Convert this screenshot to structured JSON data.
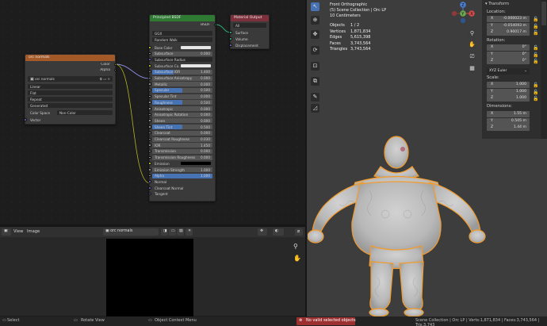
{
  "node_editor": {
    "orc_node": {
      "title": "orc normals",
      "outputs": [
        "Color",
        "Alpha"
      ],
      "image_name": "orc normals",
      "interpolation": "Linear",
      "projection": "Flat",
      "extension": "Repeat",
      "source": "Generated",
      "color_space_label": "Color Space",
      "color_space_value": "Non-Color",
      "vector_label": "Vector"
    },
    "bsdf_node": {
      "title": "Principled BSDF",
      "output": "BSDF",
      "distribution": "GGX",
      "subsurface_method": "Random Walk",
      "rows": [
        {
          "label": "Base Color",
          "value": "",
          "type": "color"
        },
        {
          "label": "Subsurface",
          "value": "0.000",
          "type": "field"
        },
        {
          "label": "Subsurface Radius",
          "value": "",
          "type": "dd"
        },
        {
          "label": "Subsurface Co...",
          "value": "",
          "type": "color"
        },
        {
          "label": "Subsurface IOR",
          "value": "1.400",
          "type": "blue"
        },
        {
          "label": "Subsurface Anisotropy",
          "value": "0.000",
          "type": "field"
        },
        {
          "label": "Metallic",
          "value": "0.000",
          "type": "field"
        },
        {
          "label": "Specular",
          "value": "0.500",
          "type": "blue"
        },
        {
          "label": "Specular Tint",
          "value": "0.000",
          "type": "field"
        },
        {
          "label": "Roughness",
          "value": "0.500",
          "type": "blue"
        },
        {
          "label": "Anisotropic",
          "value": "0.000",
          "type": "field"
        },
        {
          "label": "Anisotropic Rotation",
          "value": "0.000",
          "type": "field"
        },
        {
          "label": "Sheen",
          "value": "0.000",
          "type": "field"
        },
        {
          "label": "Sheen Tint",
          "value": "0.500",
          "type": "blue"
        },
        {
          "label": "Clearcoat",
          "value": "0.000",
          "type": "field"
        },
        {
          "label": "Clearcoat Roughness",
          "value": "0.030",
          "type": "field"
        },
        {
          "label": "IOR",
          "value": "1.450",
          "type": "field"
        },
        {
          "label": "Transmission",
          "value": "0.000",
          "type": "field"
        },
        {
          "label": "Transmission Roughness",
          "value": "0.000",
          "type": "field"
        },
        {
          "label": "Emission",
          "value": "",
          "type": "color"
        },
        {
          "label": "Emission Strength",
          "value": "1.000",
          "type": "field"
        },
        {
          "label": "Alpha",
          "value": "1.000",
          "type": "blue"
        },
        {
          "label": "Normal",
          "value": "",
          "type": "plain"
        },
        {
          "label": "Clearcoat Normal",
          "value": "",
          "type": "plain"
        },
        {
          "label": "Tangent",
          "value": "",
          "type": "plain"
        }
      ]
    },
    "output_node": {
      "title": "Material Output",
      "target": "All",
      "inputs": [
        "Surface",
        "Volume",
        "Displacement"
      ]
    }
  },
  "image_editor": {
    "menu_view": "View",
    "menu_image": "Image",
    "image_name": "orc normals"
  },
  "viewport": {
    "view_name": "Front Orthographic",
    "collection": "(5) Scene Collection | Orc LP",
    "scale": "10 Centimeters",
    "stats": [
      {
        "label": "Objects",
        "value": "1 / 2"
      },
      {
        "label": "Vertices",
        "value": "1,871,834"
      },
      {
        "label": "Edges",
        "value": "5,615,398"
      },
      {
        "label": "Faces",
        "value": "3,743,564"
      },
      {
        "label": "Triangles",
        "value": "3,743,564"
      }
    ],
    "gizmo": {
      "z": "Z",
      "y": "Y",
      "x": "X"
    }
  },
  "npanel": {
    "transform_title": "Transform",
    "location_title": "Location:",
    "location": [
      {
        "axis": "X",
        "value": "-0.000023 m"
      },
      {
        "axis": "Y",
        "value": "-0.054093 m"
      },
      {
        "axis": "Z",
        "value": "0.90017 m"
      }
    ],
    "rotation_title": "Rotation:",
    "rotation": [
      {
        "axis": "X",
        "value": "0°"
      },
      {
        "axis": "Y",
        "value": "0°"
      },
      {
        "axis": "Z",
        "value": "0°"
      }
    ],
    "rotation_mode": "XYZ Euler",
    "scale_title": "Scale:",
    "scale": [
      {
        "axis": "X",
        "value": "1.000"
      },
      {
        "axis": "Y",
        "value": "1.000"
      },
      {
        "axis": "Z",
        "value": "1.000"
      }
    ],
    "dimensions_title": "Dimensions:",
    "dimensions": [
      {
        "axis": "X",
        "value": "1.55 m"
      },
      {
        "axis": "Y",
        "value": "0.505 m"
      },
      {
        "axis": "Z",
        "value": "1.44 m"
      }
    ]
  },
  "statusbar": {
    "select": "Select",
    "rotate": "Rotate View",
    "context": "Object Context Menu",
    "warning": "No valid selected objects",
    "info": "Scene Collection | Orc LP | Verts:1,871,834 | Faces:3,743,564 | Tris:3,743"
  },
  "colors": {
    "image_node_header": "#a35a28",
    "bsdf_node_header": "#2e7a33",
    "output_node_header": "#7d2f3c",
    "accent": "#4772b3",
    "selection_outline": "#f39b2b"
  }
}
